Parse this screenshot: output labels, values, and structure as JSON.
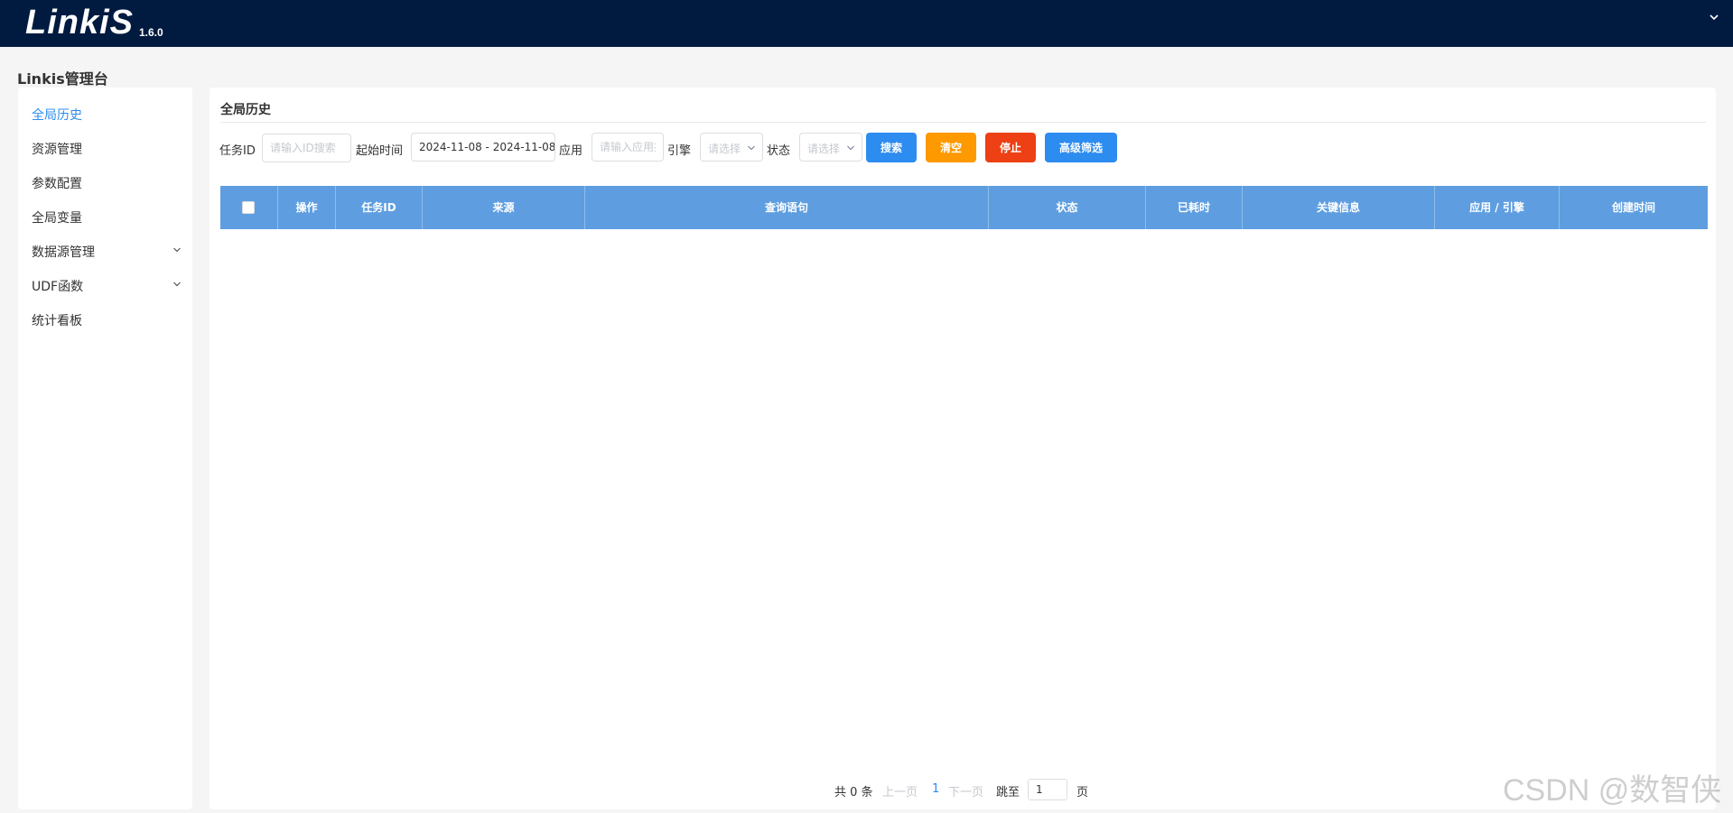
{
  "header": {
    "logo_text": "LinkiS",
    "version": "1.6.0",
    "menu_icon": "chevron-down-icon"
  },
  "console_title": "Linkis管理台",
  "sidebar": {
    "items": [
      {
        "label": "全局历史",
        "active": true
      },
      {
        "label": "资源管理"
      },
      {
        "label": "参数配置"
      },
      {
        "label": "全局变量"
      },
      {
        "label": "数据源管理",
        "expandable": true
      },
      {
        "label": "UDF函数",
        "expandable": true
      },
      {
        "label": "统计看板"
      }
    ]
  },
  "panel": {
    "title": "全局历史"
  },
  "filters": {
    "task_id_label": "任务ID",
    "task_id_placeholder": "请输入ID搜索",
    "start_time_label": "起始时间",
    "date_range_value": "2024-11-08 - 2024-11-08",
    "app_label": "应用",
    "app_placeholder": "请输入应用搜索",
    "engine_label": "引擎",
    "engine_placeholder": "请选择",
    "status_label": "状态",
    "status_placeholder": "请选择"
  },
  "buttons": {
    "search": "搜索",
    "clear": "清空",
    "stop": "停止",
    "advanced": "高级筛选"
  },
  "colors": {
    "search_button": "#2d8cf0",
    "clear_button": "#ff9900",
    "stop_button": "#ed4014",
    "advanced_button": "#2d8cf0",
    "table_header": "#5e9ee0",
    "active_nav": "#2d8cf0",
    "header_bg": "#001a40"
  },
  "table": {
    "columns": [
      "操作",
      "任务ID",
      "来源",
      "查询语句",
      "状态",
      "已耗时",
      "关键信息",
      "应用 / 引擎",
      "创建时间"
    ],
    "rows": []
  },
  "pagination": {
    "total": "共 0 条",
    "prev": "上一页",
    "current": "1",
    "next": "下一页",
    "jump_label": "跳至",
    "jump_value": "1",
    "page_suffix": "页"
  },
  "watermark": "CSDN @数智侠"
}
